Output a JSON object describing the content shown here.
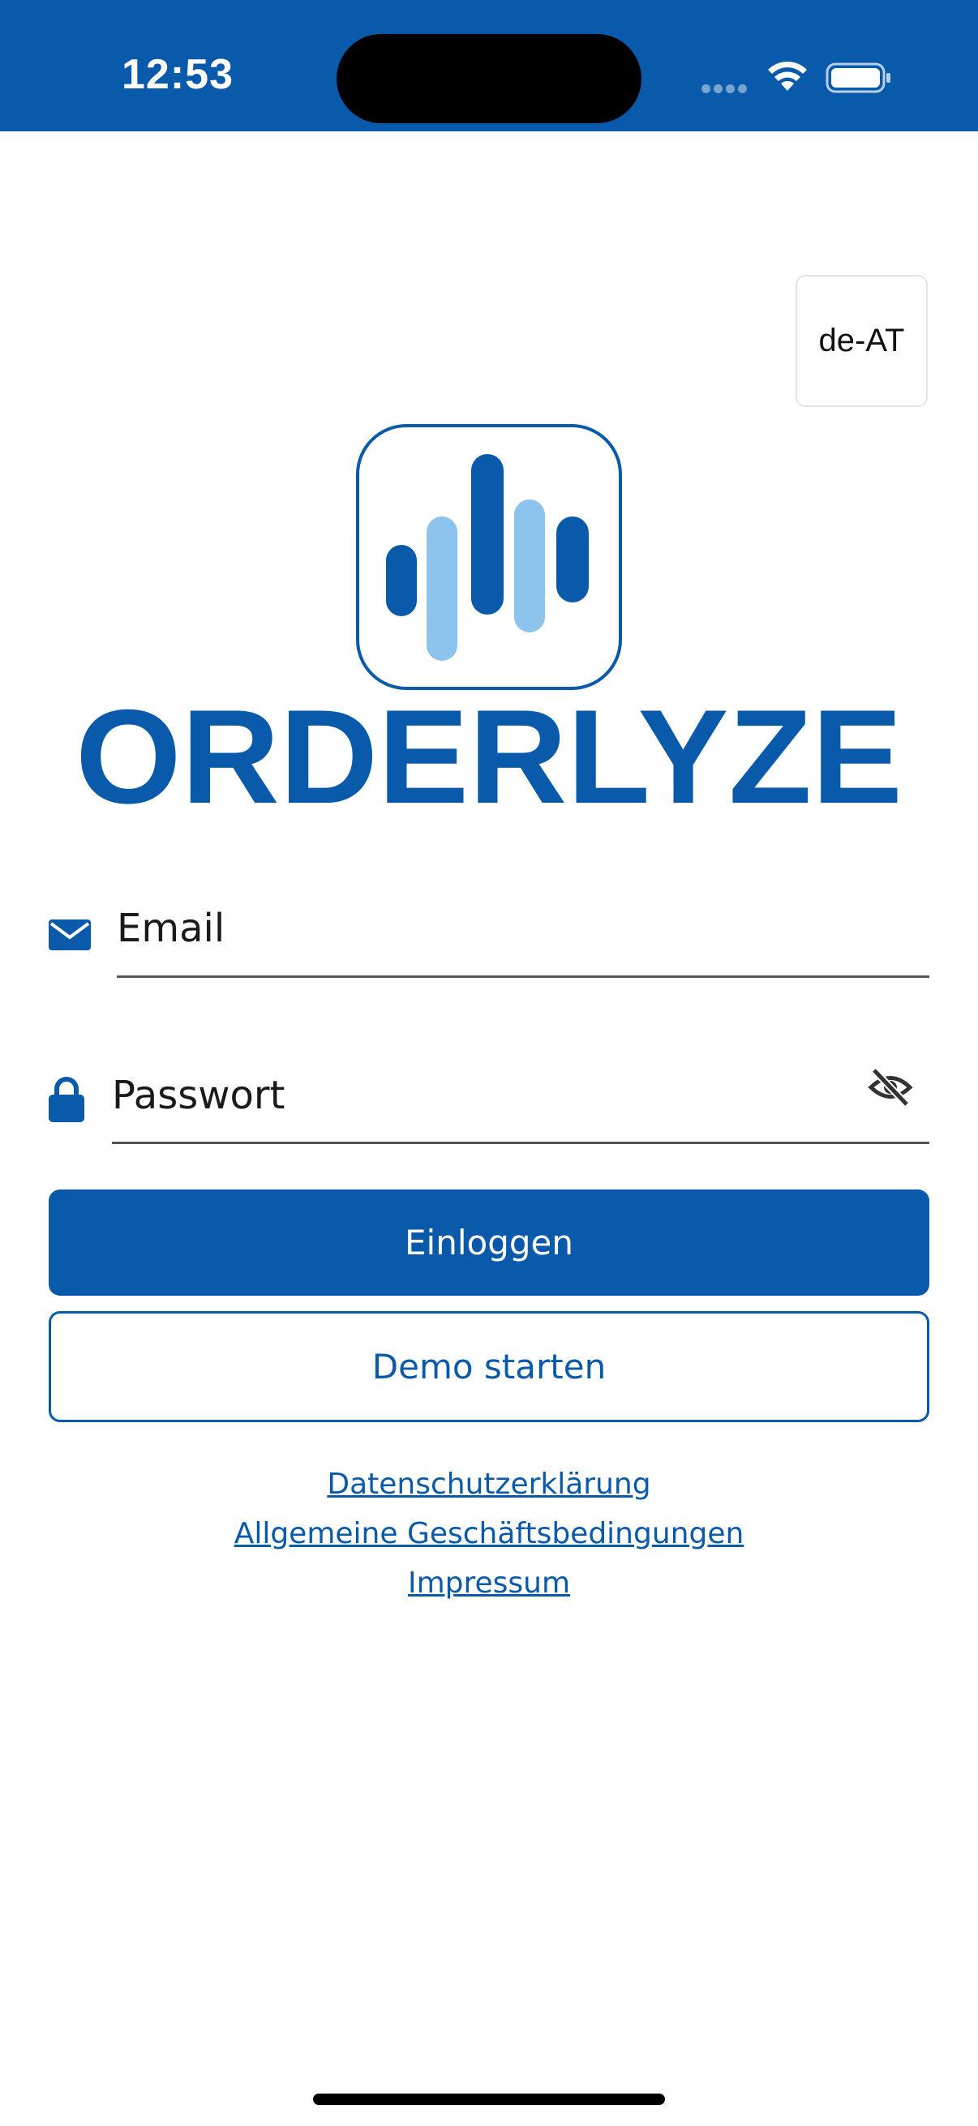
{
  "status_bar": {
    "time": "12:53",
    "icons": [
      "cellular-signal-icon",
      "wifi-icon",
      "battery-icon"
    ],
    "background_color": "#0a5aab"
  },
  "locale_button": {
    "label": "de-AT"
  },
  "logo": {
    "wordmark": "ORDERLYZE",
    "colors": {
      "dark_blue": "#0a5aab",
      "light_blue": "#8cc4ee"
    }
  },
  "form": {
    "email": {
      "value": "",
      "placeholder": "Email",
      "icon": "envelope-icon"
    },
    "password": {
      "value": "",
      "placeholder": "Passwort",
      "icon": "lock-icon",
      "toggle_icon": "eye-off-icon"
    }
  },
  "buttons": {
    "login_label": "Einloggen",
    "demo_label": "Demo starten"
  },
  "links": {
    "privacy": "Datenschutzerklärung",
    "terms": "Allgemeine Geschäftsbedingungen",
    "imprint": "Impressum"
  },
  "colors": {
    "primary": "#0a5aab",
    "text": "#1a1a1a"
  }
}
